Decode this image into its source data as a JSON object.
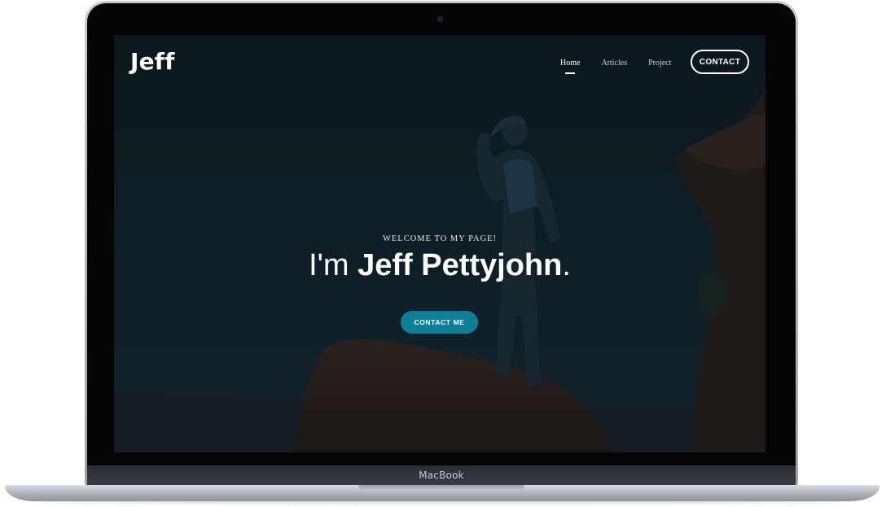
{
  "device": {
    "label": "MacBook"
  },
  "site": {
    "logo": "Jeff",
    "nav": {
      "home": "Home",
      "articles": "Articles",
      "project": "Project",
      "contact": "CONTACT"
    },
    "hero": {
      "kicker": "WELCOME TO MY PAGE!",
      "title_prefix": "I'm ",
      "title_name": "Jeff Pettyjohn",
      "title_suffix": ".",
      "cta": "CONTACT ME"
    }
  },
  "colors": {
    "accent": "#0e7f99",
    "screen_overlay": "#111c22"
  }
}
